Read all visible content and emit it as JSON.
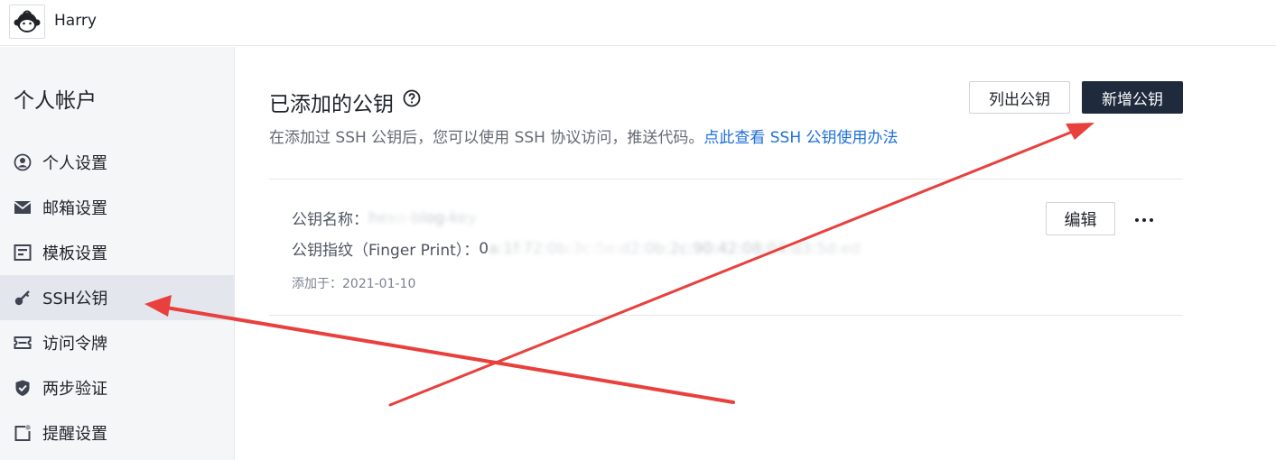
{
  "header": {
    "username": "Harry"
  },
  "sidebar": {
    "title": "个人帐户",
    "items": [
      {
        "label": "个人设置",
        "icon": "user-circle-icon"
      },
      {
        "label": "邮箱设置",
        "icon": "mail-icon"
      },
      {
        "label": "模板设置",
        "icon": "template-icon"
      },
      {
        "label": "SSH公钥",
        "icon": "key-icon",
        "active": true
      },
      {
        "label": "访问令牌",
        "icon": "ticket-icon"
      },
      {
        "label": "两步验证",
        "icon": "shield-check-icon"
      },
      {
        "label": "提醒设置",
        "icon": "bell-square-icon"
      }
    ]
  },
  "main": {
    "title": "已添加的公钥",
    "description": "在添加过 SSH 公钥后，您可以使用 SSH 协议访问，推送代码。",
    "description_link": "点此查看 SSH 公钥使用办法",
    "list_keys_button": "列出公钥",
    "add_key_button": "新增公钥",
    "key": {
      "name_label": "公钥名称：",
      "name_value": "hexo-blog-key",
      "fingerprint_label": "公钥指纹（Finger Print）：",
      "fingerprint_prefix": "0",
      "fingerprint_value": "a:1f:72:0b:3c:5e:d2:0b:2c:90:42:08:04:d3:5d:ed",
      "added_label": "添加于：",
      "added_date": "2021-01-10",
      "edit_button": "编辑",
      "more_icon": "more-horizontal-icon"
    },
    "help_icon": "question-circle-icon"
  },
  "annotation_color": "#e8403c"
}
